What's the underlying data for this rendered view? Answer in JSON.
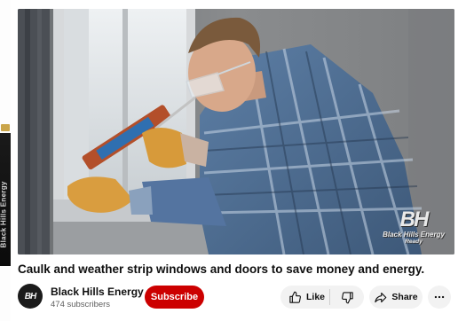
{
  "left_edge": {
    "side_text": "Black Hills Energy"
  },
  "player": {
    "brand_mark": "BH",
    "brand_name": "Black Hills Energy",
    "brand_tag": "Ready"
  },
  "video": {
    "title": "Caulk and weather strip windows and doors to save money and energy."
  },
  "channel": {
    "avatar_text": "BH",
    "name": "Black Hills Energy",
    "subscribers": "474 subscribers",
    "subscribe_label": "Subscribe"
  },
  "actions": {
    "like_label": "Like",
    "share_label": "Share",
    "like_icon": "thumbs-up-icon",
    "dislike_icon": "thumbs-down-icon",
    "share_icon": "share-arrow-icon",
    "more_icon": "more-horizontal-icon"
  },
  "colors": {
    "subscribe_bg": "#cc0000",
    "pill_bg": "#f2f2f2",
    "subtext": "#606060"
  }
}
